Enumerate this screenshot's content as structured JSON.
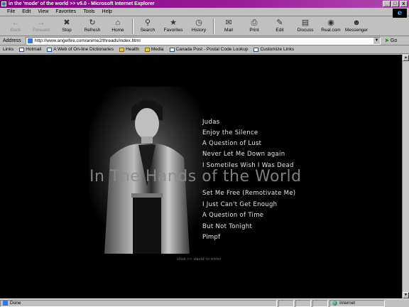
{
  "window": {
    "title": "in the 'mode' of the world >> v5.0 - Microsoft Internet Explorer",
    "buttons": [
      "_",
      "□",
      "x"
    ]
  },
  "menu": [
    "File",
    "Edit",
    "View",
    "Favorites",
    "Tools",
    "Help"
  ],
  "toolbar": {
    "back": "Back",
    "forward": "Forward",
    "stop": "Stop",
    "refresh": "Refresh",
    "home": "Home",
    "search": "Search",
    "favorites": "Favorites",
    "history": "History",
    "mail": "Mail",
    "print": "Print",
    "edit": "Edit",
    "discuss": "Discuss",
    "realcom": "Real.com",
    "messenger": "Messenger"
  },
  "address": {
    "label": "Address",
    "url": "http://www.angelfire.com/anime2/threads/index.html",
    "go": "Go"
  },
  "links": {
    "label": "Links",
    "items": [
      "Hotmail",
      "A Web of On-line Dictionaries",
      "Health",
      "Media",
      "Canada Post - Postal Code Lookup",
      "Customize Links"
    ]
  },
  "page": {
    "songs": [
      "Judas",
      "Enjoy the Silence",
      "A Question of Lust",
      "Never Let Me Down again",
      "I Sometiles Wish I Was Dead",
      "Set Me Free (Remotivate Me)",
      "I Just Can't Get Enough",
      "A Question of Time",
      "But Not Tonight",
      "Pimpf"
    ],
    "title": "In The Hands of the World",
    "enter": "click >> david to enter"
  },
  "status": {
    "text": "Done",
    "zone": "Internet"
  },
  "colors": {
    "titlebar": "#800080",
    "page_background": "#000000",
    "song_text": "#e6e6e6",
    "title_text": "#8c8c8c"
  }
}
